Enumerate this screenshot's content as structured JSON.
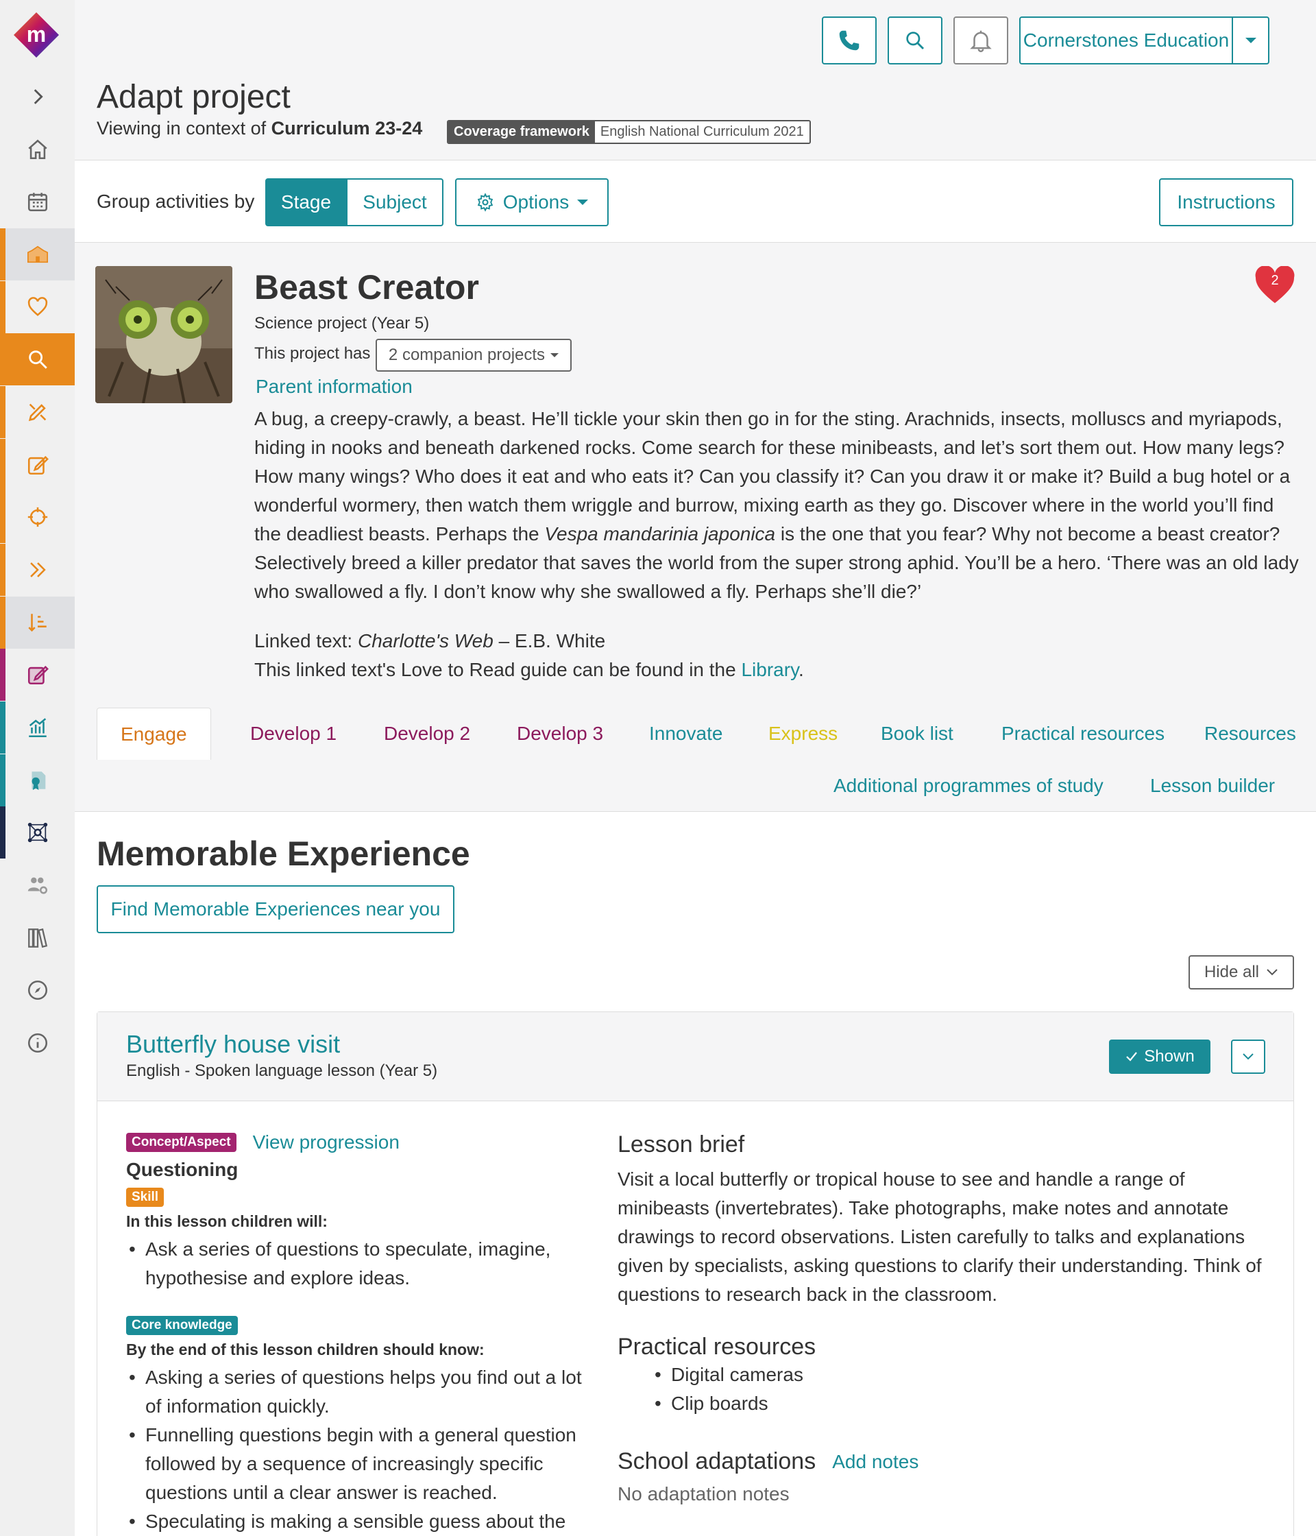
{
  "header": {
    "school": "Cornerstones Education",
    "page_title": "Adapt project",
    "context_prefix": "Viewing in context of",
    "context_curriculum": "Curriculum 23-24",
    "coverage_label": "Coverage framework",
    "coverage_value": "English National Curriculum 2021"
  },
  "toolbar": {
    "group_label": "Group activities by",
    "stage": "Stage",
    "subject": "Subject",
    "options": "Options",
    "instructions": "Instructions"
  },
  "project": {
    "title": "Beast Creator",
    "subtitle": "Science project (Year 5)",
    "companion_label": "This project has",
    "companion_btn": "2 companion projects",
    "parent_info": "Parent information",
    "favourites": "2",
    "desc_1": "A bug, a creepy-crawly, a beast. He’ll tickle your skin then go in for the sting. Arachnids, insects, molluscs and myriapods, hiding in nooks and beneath darkened rocks. Come search for these minibeasts, and let’s sort them out. How many legs? How many wings? Who does it eat and who eats it? Can you classify it? Can you draw it or make it? Build a bug hotel or a wonderful wormery, then watch them wriggle and burrow, mixing earth as they go. Discover where in the world you’ll find the deadliest beasts. Perhaps the ",
    "desc_italic": "Vespa mandarinia japonica",
    "desc_2": " is the one that you fear? Why not become a beast creator? Selectively breed a killer predator that saves the world from the super strong aphid. You’ll be a hero. ‘There was an old lady who swallowed a fly. I don’t know why she swallowed a fly. Perhaps she’ll die?’",
    "linked_prefix": "Linked text: ",
    "linked_title": "Charlotte's Web",
    "linked_author": " – E.B. White",
    "guide_prefix": "This linked text's Love to Read guide can be found in the ",
    "guide_link": "Library",
    "guide_suffix": "."
  },
  "tabs": [
    {
      "label": "Engage",
      "color": "#d6761a"
    },
    {
      "label": "Develop 1",
      "color": "#8c1a5c"
    },
    {
      "label": "Develop 2",
      "color": "#8c1a5c"
    },
    {
      "label": "Develop 3",
      "color": "#8c1a5c"
    },
    {
      "label": "Innovate",
      "color": "#1a8c97"
    },
    {
      "label": "Express",
      "color": "#d9c21a"
    },
    {
      "label": "Book list",
      "color": "#1a8c97"
    },
    {
      "label": "Practical resources",
      "color": "#1a8c97"
    },
    {
      "label": "Resources",
      "color": "#1a8c97"
    },
    {
      "label": "Additional programmes of study",
      "color": "#1a8c97"
    },
    {
      "label": "Lesson builder",
      "color": "#1a8c97"
    }
  ],
  "memorable": {
    "title": "Memorable Experience",
    "find_btn": "Find Memorable Experiences near you",
    "hide_all": "Hide all"
  },
  "lesson": {
    "title": "Butterfly house visit",
    "subtitle": "English - Spoken language lesson (Year 5)",
    "shown": "Shown",
    "concept_pill": "Concept/Aspect",
    "view_progression": "View progression",
    "concept_name": "Questioning",
    "skill_pill": "Skill",
    "children_will": "In this lesson children will:",
    "skill_items": [
      "Ask a series of questions to speculate, imagine, hypothesise and explore ideas."
    ],
    "core_pill": "Core knowledge",
    "children_know": "By the end of this lesson children should know:",
    "core_items": [
      "Asking a series of questions helps you find out a lot of information quickly.",
      "Funnelling questions begin with a general question followed by a sequence of increasingly specific questions until a clear answer is reached.",
      "Speculating is making a sensible guess about the"
    ],
    "brief_title": "Lesson brief",
    "brief_text": "Visit a local butterfly or tropical house to see and handle a range of minibeasts (invertebrates). Take photographs, make notes and annotate drawings to record observations. Listen carefully to talks and explanations given by specialists, asking questions to clarify their understanding. Think of questions to research back in the classroom.",
    "practical_title": "Practical resources",
    "practical_items": [
      "Digital cameras",
      "Clip boards"
    ],
    "adapt_title": "School adaptations",
    "add_notes": "Add notes",
    "no_notes": "No adaptation notes"
  },
  "colors": {
    "teal": "#1a8c97",
    "orange": "#e8891c",
    "magenta": "#a3246f",
    "navy": "#1e2a4a",
    "heart": "#e0343f"
  }
}
